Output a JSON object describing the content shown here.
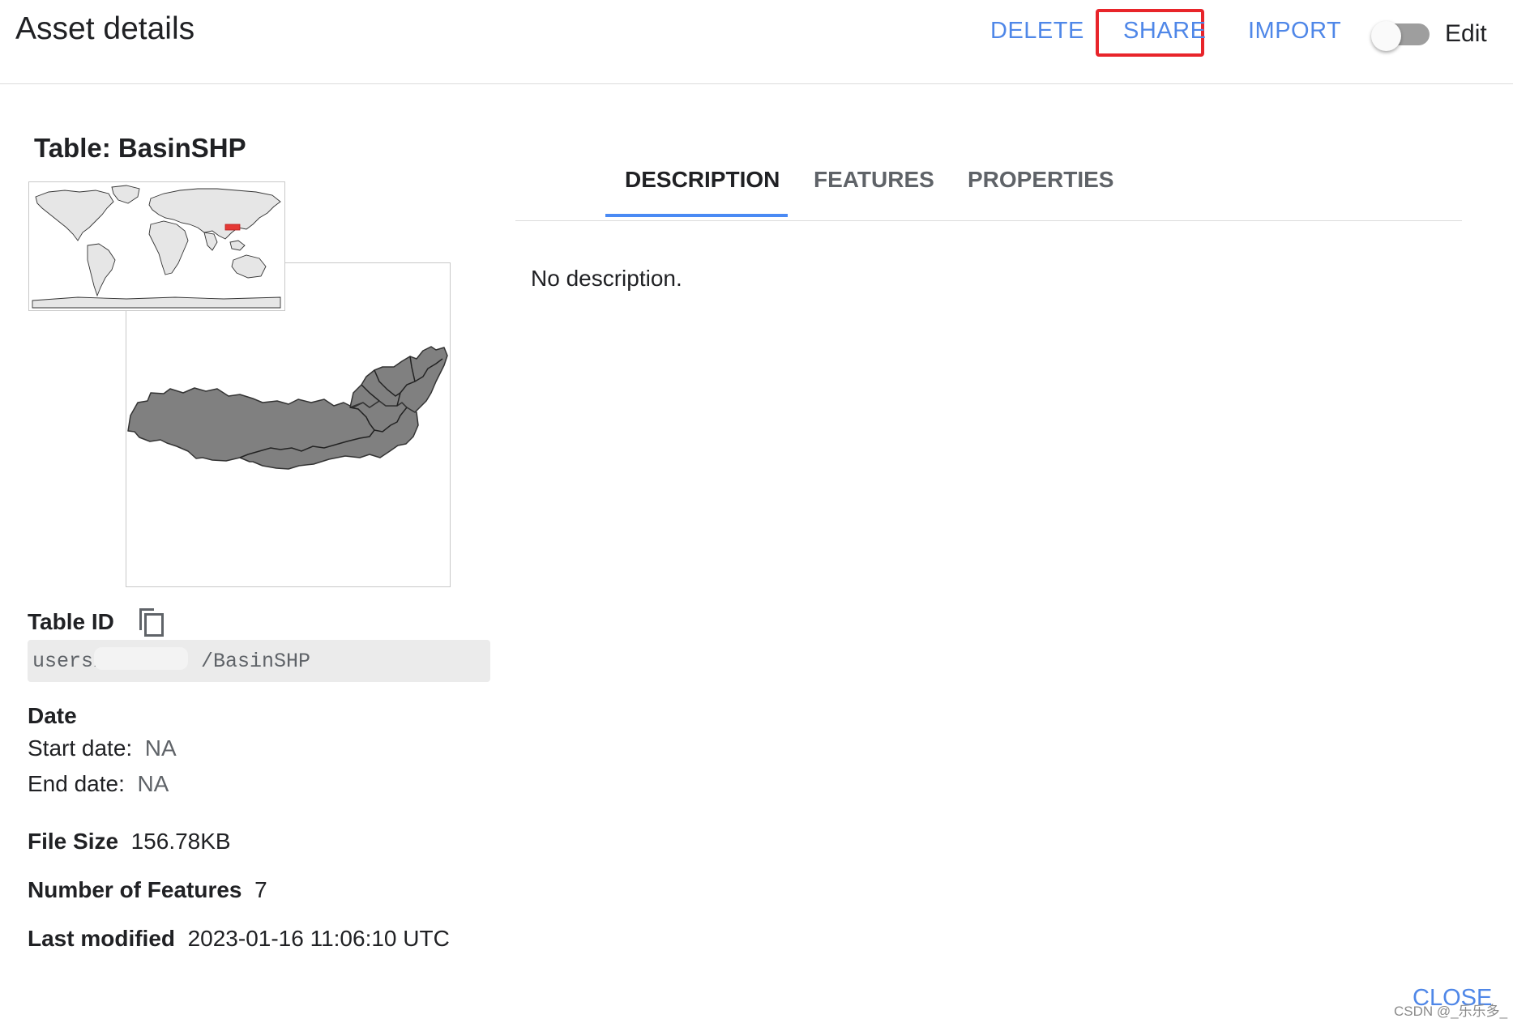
{
  "header": {
    "title": "Asset details",
    "delete_label": "DELETE",
    "share_label": "SHARE",
    "import_label": "IMPORT",
    "edit_label": "Edit",
    "edit_toggle_on": false
  },
  "asset": {
    "title": "Table: BasinSHP",
    "table_id_label": "Table ID",
    "table_id_prefix": "users/",
    "table_id_suffix": "/BasinSHP",
    "date_heading": "Date",
    "start_date_label": "Start date:",
    "start_date_value": "NA",
    "end_date_label": "End date:",
    "end_date_value": "NA",
    "file_size_label": "File Size",
    "file_size_value": "156.78KB",
    "num_features_label": "Number of Features",
    "num_features_value": "7",
    "last_modified_label": "Last modified",
    "last_modified_value": "2023-01-16 11:06:10 UTC"
  },
  "tabs": [
    {
      "label": "DESCRIPTION",
      "active": true
    },
    {
      "label": "FEATURES",
      "active": false
    },
    {
      "label": "PROPERTIES",
      "active": false
    }
  ],
  "description": "No description.",
  "footer": {
    "close_label": "CLOSE",
    "watermark": "CSDN @_乐乐多_"
  },
  "colors": {
    "accent": "#4f87e8",
    "tab_indicator": "#4a8af4",
    "highlight_box": "#e8242a",
    "basin_fill": "#808080"
  }
}
